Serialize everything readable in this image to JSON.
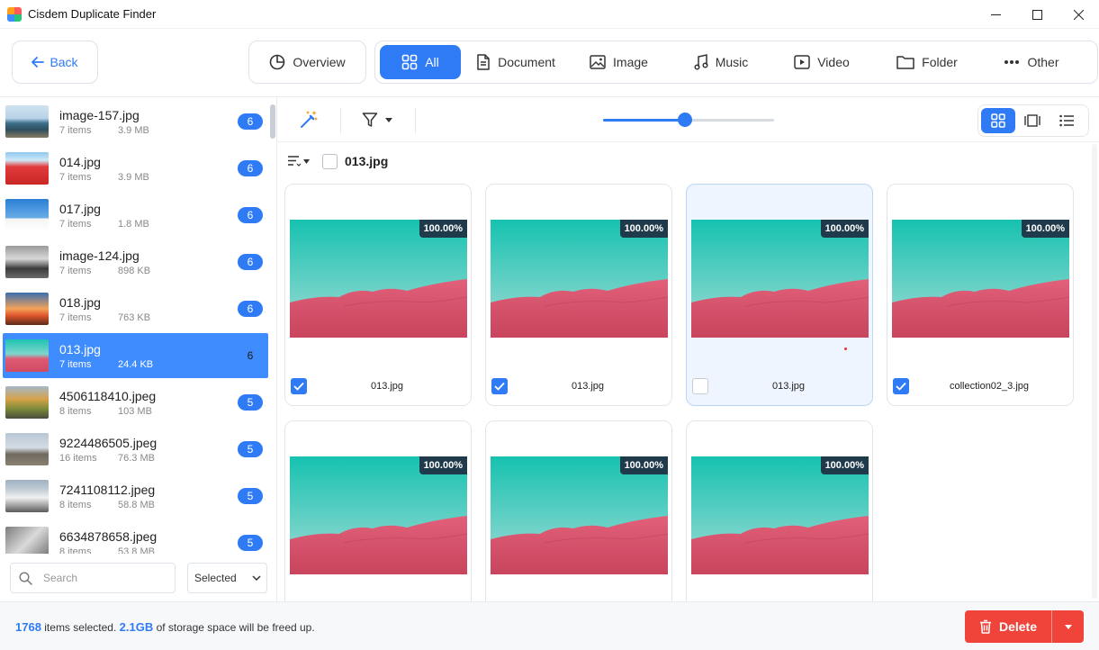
{
  "window": {
    "title": "Cisdem Duplicate Finder"
  },
  "toolbar": {
    "back_label": "Back",
    "overview_label": "Overview",
    "tabs": [
      {
        "label": "All",
        "icon": "grid-icon",
        "active": true
      },
      {
        "label": "Document",
        "icon": "document-icon",
        "active": false
      },
      {
        "label": "Image",
        "icon": "image-icon",
        "active": false
      },
      {
        "label": "Music",
        "icon": "music-icon",
        "active": false
      },
      {
        "label": "Video",
        "icon": "video-icon",
        "active": false
      },
      {
        "label": "Folder",
        "icon": "folder-icon",
        "active": false
      },
      {
        "label": "Other",
        "icon": "more-icon",
        "active": false
      }
    ]
  },
  "sidebar": {
    "groups": [
      {
        "name": "image-157.jpg",
        "items": "7 items",
        "size": "3.9 MB",
        "count": "6",
        "thumb": "coast",
        "selected": false
      },
      {
        "name": "014.jpg",
        "items": "7 items",
        "size": "3.9 MB",
        "count": "6",
        "thumb": "red",
        "selected": false
      },
      {
        "name": "017.jpg",
        "items": "7 items",
        "size": "1.8 MB",
        "count": "6",
        "thumb": "church",
        "selected": false
      },
      {
        "name": "image-124.jpg",
        "items": "7 items",
        "size": "898 KB",
        "count": "6",
        "thumb": "bw",
        "selected": false
      },
      {
        "name": "018.jpg",
        "items": "7 items",
        "size": "763 KB",
        "count": "6",
        "thumb": "sunset",
        "selected": false
      },
      {
        "name": "013.jpg",
        "items": "7 items",
        "size": "24.4 KB",
        "count": "6",
        "thumb": "dune",
        "selected": true
      },
      {
        "name": "4506118410.jpeg",
        "items": "8 items",
        "size": "103 MB",
        "count": "5",
        "thumb": "autumn",
        "selected": false
      },
      {
        "name": "9224486505.jpeg",
        "items": "16 items",
        "size": "76.3 MB",
        "count": "5",
        "thumb": "city",
        "selected": false
      },
      {
        "name": "7241108112.jpeg",
        "items": "8 items",
        "size": "58.8 MB",
        "count": "5",
        "thumb": "temple",
        "selected": false
      },
      {
        "name": "6634878658.jpeg",
        "items": "8 items",
        "size": "53.8 MB",
        "count": "5",
        "thumb": "arch",
        "selected": false
      }
    ],
    "search_placeholder": "Search",
    "sort_value": "Selected"
  },
  "main": {
    "slider_value": 0.48,
    "view_modes": [
      "grid-view-icon",
      "compare-view-icon",
      "list-view-icon"
    ],
    "group_title": "013.jpg",
    "files": [
      {
        "name": "013.jpg",
        "similarity": "100.00%",
        "checked": true,
        "highlight": false
      },
      {
        "name": "013.jpg",
        "similarity": "100.00%",
        "checked": true,
        "highlight": false
      },
      {
        "name": "013.jpg",
        "similarity": "100.00%",
        "checked": false,
        "highlight": true
      },
      {
        "name": "collection02_3.jpg",
        "similarity": "100.00%",
        "checked": true,
        "highlight": false
      },
      {
        "name": "",
        "similarity": "100.00%",
        "checked": false,
        "highlight": false
      },
      {
        "name": "",
        "similarity": "100.00%",
        "checked": false,
        "highlight": false
      },
      {
        "name": "",
        "similarity": "100.00%",
        "checked": false,
        "highlight": false
      }
    ]
  },
  "status": {
    "selected_count": "1768",
    "selected_suffix": "items selected.",
    "freed_size": "2.1GB",
    "freed_suffix": "of storage space will be freed up.",
    "delete_label": "Delete"
  },
  "colors": {
    "accent": "#2f7bf5",
    "danger": "#f0443a"
  }
}
